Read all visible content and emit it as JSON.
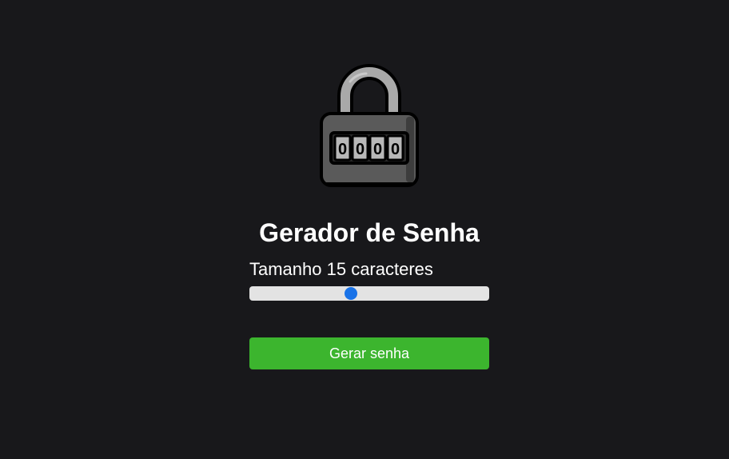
{
  "app": {
    "logo_icon": "combination-padlock-icon",
    "padlock_digits": [
      "0",
      "0",
      "0",
      "0"
    ]
  },
  "header": {
    "title": "Gerador de Senha"
  },
  "length": {
    "label": "Tamanho 15 caracteres",
    "value": 15,
    "slider_fraction": 0.42
  },
  "actions": {
    "generate_label": "Gerar senha"
  },
  "colors": {
    "background": "#18181b",
    "accent": "#1a73e8",
    "button": "#3cb52e"
  }
}
